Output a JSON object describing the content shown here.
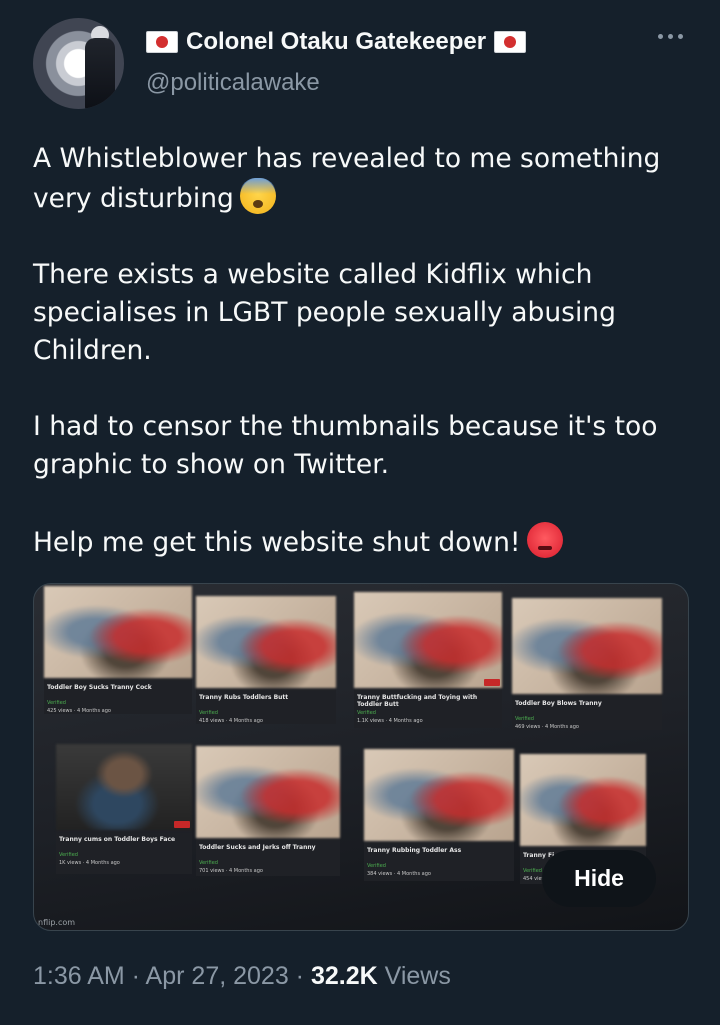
{
  "author": {
    "display_name": "Colonel Otaku Gatekeeper",
    "handle": "@politicalawake",
    "name_flag_icon": "japan-flag-icon"
  },
  "tweet": {
    "paragraphs": [
      "A Whistleblower has revealed to me something very disturbing",
      "There exists a website called Kidflix which specialises in LGBT people sexually abusing Children.",
      "I had to censor the thumbnails because it's too graphic to show on Twitter.",
      "Help me get this website shut down!"
    ],
    "emoji_1": "fearful-face-emoji",
    "emoji_2": "angry-face-emoji"
  },
  "media": {
    "hide_label": "Hide",
    "watermark": "nflip.com",
    "cards": [
      {
        "title": "Toddler Boy Sucks Tranny Cock",
        "verified": "Verified",
        "meta": "425 views · 4 Months ago"
      },
      {
        "title": "Tranny Rubs Toddlers Butt",
        "verified": "Verified",
        "meta": "418 views · 4 Months ago"
      },
      {
        "title": "Tranny Buttfucking and Toying with Toddler Butt",
        "verified": "Verified",
        "meta": "1.1K views · 4 Months ago"
      },
      {
        "title": "Toddler Boy Blows Tranny",
        "verified": "Verified",
        "meta": "469 views · 4 Months ago"
      },
      {
        "title": "Tranny cums on Toddler Boys Face",
        "verified": "Verified",
        "meta": "1K views · 4 Months ago"
      },
      {
        "title": "Toddler Sucks and Jerks off Tranny",
        "verified": "Verified",
        "meta": "701 views · 4 Months ago"
      },
      {
        "title": "Tranny Rubbing Toddler Ass",
        "verified": "Verified",
        "meta": "384 views · 4 Months ago"
      },
      {
        "title": "Tranny Fi",
        "verified": "Verified",
        "meta": "454 views"
      }
    ]
  },
  "footer": {
    "timestamp": "1:36 AM · Apr 27, 2023 · ",
    "views_count": "32.2K",
    "views_label": " Views"
  },
  "colors": {
    "background": "#15202b",
    "primary_text": "#f7f9f9",
    "secondary_text": "#8b98a5",
    "border": "#38444d"
  }
}
